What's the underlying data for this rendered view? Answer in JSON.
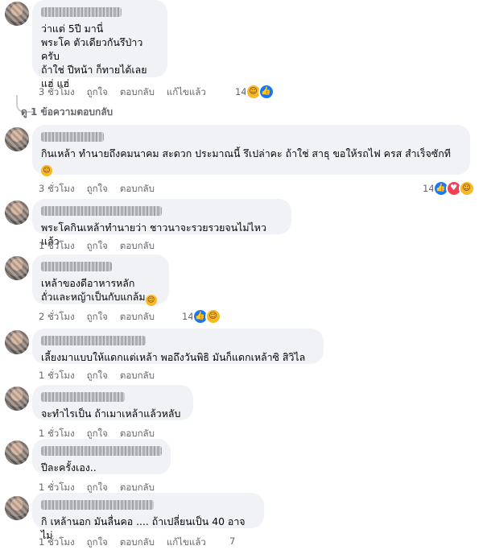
{
  "comments": [
    {
      "text": "ว่าแต่ 5ปี มานี่\nพระโค ตัวเดียวกันรึป่าวครับ\nถ้าใช่ ปีหน้า ก็ทายได้เลย\nแฮ่ แฮ่",
      "time": "3 ชั่วโมง",
      "like": "ถูกใจ",
      "reply": "ตอบกลับ",
      "edited": "แก้ไขแล้ว",
      "reaction_count": "14",
      "reactions": [
        "haha",
        "like"
      ]
    },
    {
      "text": "กินเหล้า ทำนายถึงคมนาคม สะดวก ประมาณนี้ รึเปล่าคะ ถ้าใช่ สาธุ ขอให้รถไฟ ครส สำเร็จซักที",
      "time": "3 ชั่วโมง",
      "like": "ถูกใจ",
      "reply": "ตอบกลับ",
      "reaction_count": "14",
      "reactions": [
        "like",
        "love",
        "haha"
      ]
    },
    {
      "text": "พระโคกินเหล้าทำนายว่า ชาวนาจะรวยรวยจนไม่ไหวแล้ว",
      "time": "1 ชั่วโมง",
      "like": "ถูกใจ",
      "reply": "ตอบกลับ"
    },
    {
      "text": "เหล้าของดีอาหารหลัก\nถั่วและหญ้าเป็นกับแกล้ม",
      "time": "2 ชั่วโมง",
      "like": "ถูกใจ",
      "reply": "ตอบกลับ",
      "reaction_count": "14",
      "reactions": [
        "like",
        "haha"
      ]
    },
    {
      "text": "เลี้ยงมาแบบให้แดกแต่เหล้า พอถึงวันพิธิ มันก็แดกเหล้าซิ สิวิไล",
      "time": "1 ชั่วโมง",
      "like": "ถูกใจ",
      "reply": "ตอบกลับ"
    },
    {
      "text": "จะทำไรเป็น ถ้าเมาเหล้าแล้วหลับ",
      "time": "1 ชั่วโมง",
      "like": "ถูกใจ",
      "reply": "ตอบกลับ"
    },
    {
      "text": "ปีละครั้งเอง..",
      "time": "1 ชั่วโมง",
      "like": "ถูกใจ",
      "reply": "ตอบกลับ"
    },
    {
      "text": "กิ เหล้านอก มันลื่นคอ .... ถ้าเปลี่ยนเป็น 40 อาจไม่",
      "time": "1 ชั่วโมง",
      "like": "ถูกใจ",
      "reply": "ตอบกลับ",
      "edited": "แก้ไขแล้ว",
      "reaction_count": "7"
    }
  ],
  "view_replies": "ดู 1 ข้อความตอบกลับ",
  "colors": {
    "bubble": "#f0f2f5",
    "meta": "#65676b",
    "like": "#1877f2",
    "love": "#f33e58",
    "haha": "#f7b928"
  },
  "icons": {
    "haha": "haha-reaction-icon",
    "like": "like-reaction-icon",
    "love": "love-reaction-icon"
  }
}
